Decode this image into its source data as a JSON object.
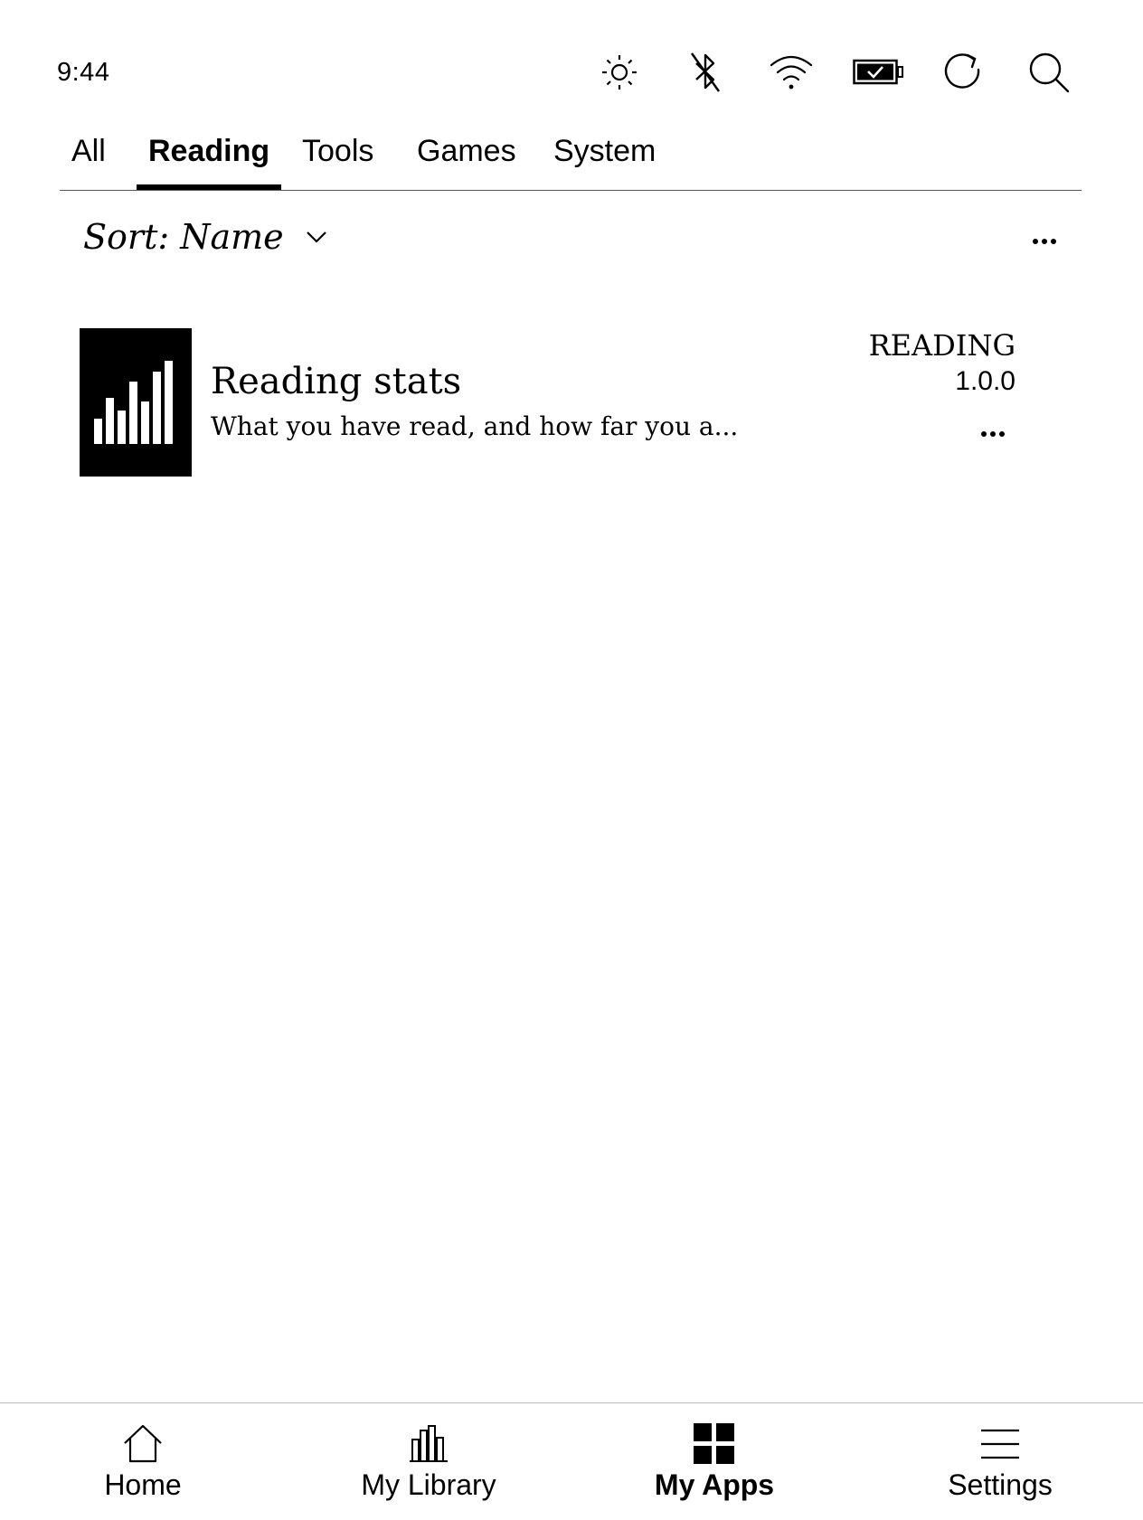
{
  "status_bar": {
    "time": "9:44",
    "icons": [
      "brightness-icon",
      "bluetooth-off-icon",
      "wifi-icon",
      "battery-charging-icon",
      "sync-icon",
      "search-icon"
    ]
  },
  "tabs": [
    {
      "label": "All",
      "active": false
    },
    {
      "label": "Reading",
      "active": true
    },
    {
      "label": "Tools",
      "active": false
    },
    {
      "label": "Games",
      "active": false
    },
    {
      "label": "System",
      "active": false
    }
  ],
  "sort": {
    "label": "Sort: Name"
  },
  "apps": [
    {
      "title": "Reading stats",
      "description": "What you have read, and how far you a...",
      "category": "READING",
      "version": "1.0.0",
      "icon": "bar-chart-icon"
    }
  ],
  "bottom_nav": [
    {
      "label": "Home",
      "icon": "home-icon",
      "active": false
    },
    {
      "label": "My Library",
      "icon": "library-icon",
      "active": false
    },
    {
      "label": "My Apps",
      "icon": "apps-grid-icon",
      "active": true
    },
    {
      "label": "Settings",
      "icon": "menu-icon",
      "active": false
    }
  ]
}
